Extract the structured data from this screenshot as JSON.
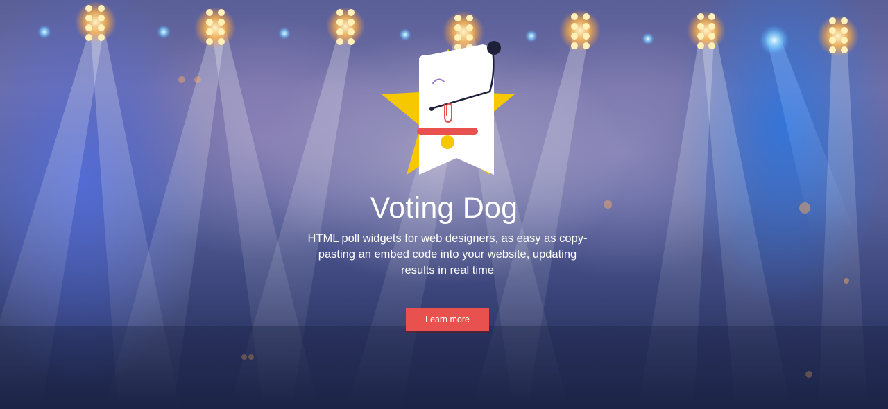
{
  "hero": {
    "title": "Voting Dog",
    "tagline": "HTML poll widgets for web designers, as easy as copy-pasting an embed code into your website, updating results in real time",
    "cta_label": "Learn more"
  },
  "logo": {
    "icon": "voting-dog-star-logo",
    "colors": {
      "star": "#f5c800",
      "dog": "#ffffff",
      "collar": "#e8514d",
      "tag": "#f5c800",
      "ear": "#1e1f3a",
      "clip": "#e8514d",
      "eye": "#9b7ac9"
    }
  },
  "theme": {
    "accent": "#e8514d",
    "text": "#ffffff",
    "background_top": "#5a5f97",
    "background_bottom": "#1c2447"
  }
}
